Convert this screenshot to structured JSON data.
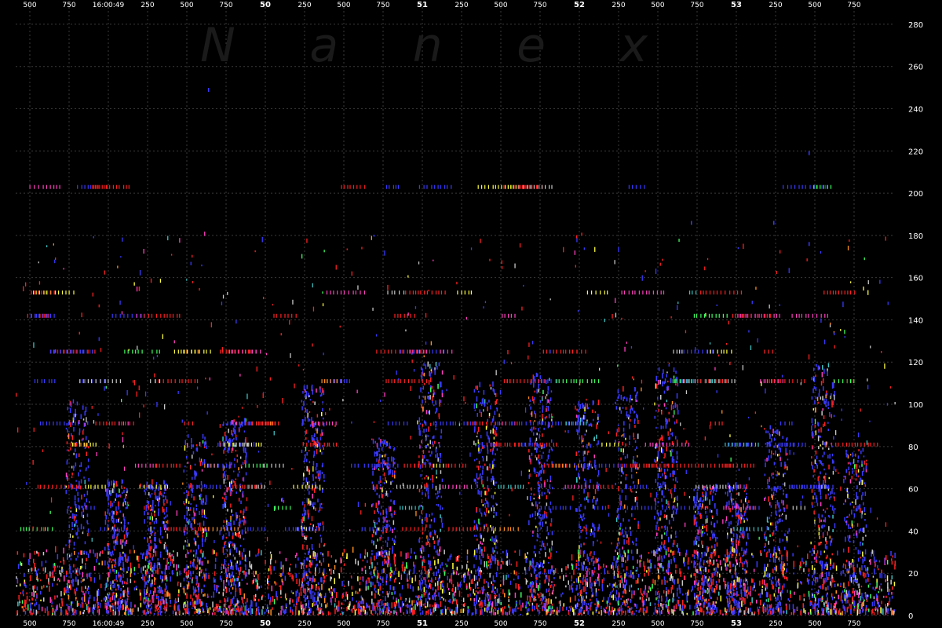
{
  "chart_data": {
    "type": "scatter",
    "watermark": "Nanex",
    "y_ticks": [
      0,
      20,
      40,
      60,
      80,
      100,
      120,
      140,
      160,
      180,
      200,
      220,
      240,
      260,
      280
    ],
    "ylim": [
      0,
      290
    ],
    "grid": true,
    "top_x_labels": [
      "500",
      "750",
      "16:00:49",
      "250",
      "500",
      "750",
      "50",
      "250",
      "500",
      "750",
      "51",
      "250",
      "500",
      "750",
      "52",
      "250",
      "500",
      "750",
      "53",
      "250",
      "500",
      "750"
    ],
    "bottom_x_labels": [
      "500",
      "750",
      "16:00:49",
      "250",
      "500",
      "750",
      "50",
      "250",
      "500",
      "750",
      "51",
      "250",
      "500",
      "750",
      "52",
      "250",
      "500",
      "750",
      "53",
      "250",
      "500",
      "750"
    ],
    "bold_x_labels": [
      "50",
      "51",
      "52",
      "53"
    ],
    "series": [
      {
        "color": "#ff2020",
        "density": 1.0
      },
      {
        "color": "#3a3aff",
        "density": 0.9
      },
      {
        "color": "#ff40c0",
        "density": 0.25
      },
      {
        "color": "#c8c8c8",
        "density": 0.3
      },
      {
        "color": "#ffff40",
        "density": 0.2
      },
      {
        "color": "#40ff60",
        "density": 0.12
      },
      {
        "color": "#ff9020",
        "density": 0.15
      },
      {
        "color": "#40c0c0",
        "density": 0.1
      }
    ],
    "activity_bursts_time": [
      "16:00:48.800",
      "16:00:49.050",
      "16:00:49.300",
      "16:00:49.550",
      "16:00:49.800",
      "16:00:50.300",
      "16:00:50.750",
      "16:00:51.050",
      "16:00:51.400",
      "16:00:51.750",
      "16:00:52.050",
      "16:00:52.300",
      "16:00:52.550",
      "16:00:52.800",
      "16:00:53.000",
      "16:00:53.250",
      "16:00:53.550",
      "16:00:53.750"
    ],
    "price_levels": [
      202,
      152,
      141,
      124,
      110,
      90,
      80,
      70,
      60,
      50,
      40
    ]
  }
}
